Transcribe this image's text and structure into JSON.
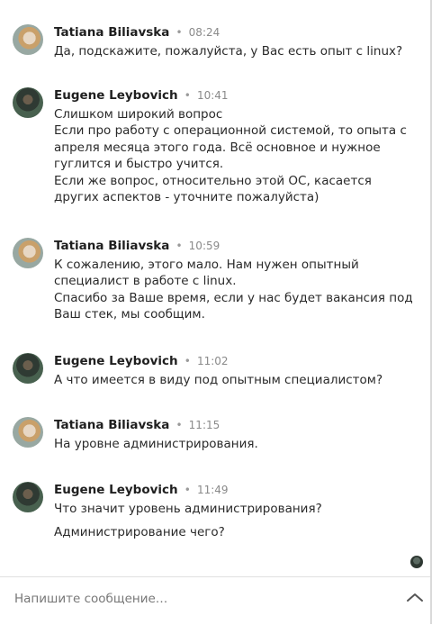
{
  "messages": [
    {
      "author": "Tatiana Biliavska",
      "time": "08:24",
      "lines": [
        "Да, подскажите, пожалуйста, у Вас есть опыт с linux?"
      ]
    },
    {
      "author": "Eugene Leybovich",
      "time": "10:41",
      "lines": [
        "Слишком широкий вопрос\nЕсли про работу с операционной системой, то опыта с апреля месяца этого года. Всё основное и нужное гуглится и быстро учится.\nЕсли же вопрос, относительно этой ОС, касается других аспектов - уточните пожалуйста)"
      ]
    },
    {
      "author": "Tatiana Biliavska",
      "time": "10:59",
      "lines": [
        "К сожалению, этого мало. Нам нужен опытный специалист в работе с linux.\nСпасибо за Ваше время, если у нас будет вакансия под Ваш стек, мы сообщим."
      ]
    },
    {
      "author": "Eugene Leybovich",
      "time": "11:02",
      "lines": [
        "А что имеется в виду под опытным специалистом?"
      ]
    },
    {
      "author": "Tatiana Biliavska",
      "time": "11:15",
      "lines": [
        "На уровне администрирования."
      ]
    },
    {
      "author": "Eugene Leybovich",
      "time": "11:49",
      "lines": [
        "Что значит уровень администрирования?",
        "Администрирование чего?"
      ]
    }
  ],
  "composer": {
    "placeholder": "Напишите сообщение…"
  },
  "icons": {
    "seen": "seen-avatar-icon",
    "expand": "chevron-up-icon"
  },
  "separator": "•"
}
